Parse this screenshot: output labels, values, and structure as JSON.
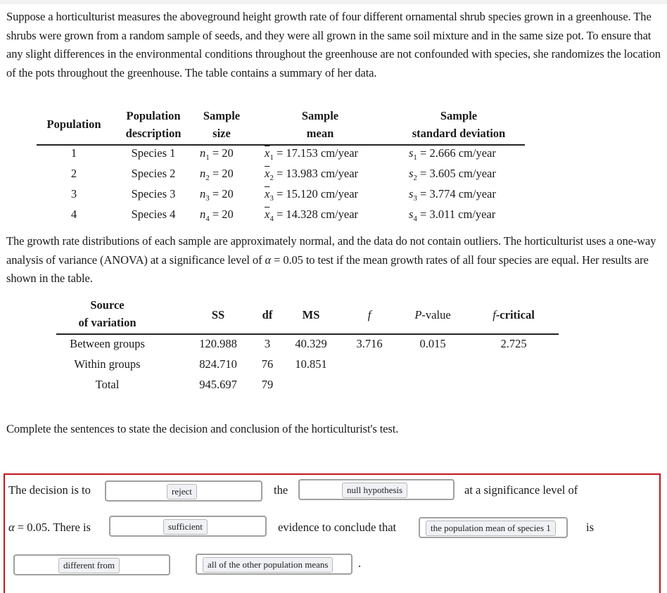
{
  "intro_text": "Suppose a horticulturist measures the aboveground height growth rate of four different ornamental shrub species grown in a greenhouse. The shrubs were grown from a random sample of seeds, and they were all grown in the same soil mixture and in the same size pot. To ensure that any slight differences in the environmental conditions throughout the greenhouse are not confounded with species, she randomizes the location of the pots throughout the greenhouse. The table contains a summary of her data.",
  "summary_table": {
    "headers": {
      "population": "Population",
      "description_1": "Population",
      "description_2": "description",
      "size_1": "Sample",
      "size_2": "size",
      "mean_1": "Sample",
      "mean_2": "mean",
      "sd_1": "Sample",
      "sd_2": "standard deviation"
    },
    "rows": [
      {
        "population": "1",
        "description": "Species 1",
        "n_sym": "n",
        "n_sub": "1",
        "n_val": " = 20",
        "x_sym": "x",
        "x_sub": "1",
        "mean": " = 17.153 cm/year",
        "s_sym": "s",
        "s_sub": "1",
        "sd": " = 2.666 cm/year"
      },
      {
        "population": "2",
        "description": "Species 2",
        "n_sym": "n",
        "n_sub": "2",
        "n_val": " = 20",
        "x_sym": "x",
        "x_sub": "2",
        "mean": " = 13.983 cm/year",
        "s_sym": "s",
        "s_sub": "2",
        "sd": " = 3.605 cm/year"
      },
      {
        "population": "3",
        "description": "Species 3",
        "n_sym": "n",
        "n_sub": "3",
        "n_val": " = 20",
        "x_sym": "x",
        "x_sub": "3",
        "mean": " = 15.120 cm/year",
        "s_sym": "s",
        "s_sub": "3",
        "sd": " = 3.774 cm/year"
      },
      {
        "population": "4",
        "description": "Species 4",
        "n_sym": "n",
        "n_sub": "4",
        "n_val": " = 20",
        "x_sym": "x",
        "x_sub": "4",
        "mean": " = 14.328 cm/year",
        "s_sym": "s",
        "s_sub": "4",
        "sd": " = 3.011 cm/year"
      }
    ]
  },
  "middle_text": {
    "part1": "The growth rate distributions of each sample are approximately normal, and the data do not contain outliers. The horticulturist uses a one-way analysis of variance (ANOVA) at a significance level of ",
    "alpha": "α",
    "part2": " = 0.05 to test if the mean growth rates of all four species are equal. Her results are shown in the table."
  },
  "anova_table": {
    "headers": {
      "source_1": "Source",
      "source_2": "of variation",
      "ss": "SS",
      "df": "df",
      "ms": "MS",
      "f": "f",
      "p_italic": "P",
      "p_rest": "-value",
      "fcrit_italic": "f",
      "fcrit_rest": "-critical"
    },
    "rows": [
      {
        "source": "Between groups",
        "ss": "120.988",
        "df": "3",
        "ms": "40.329",
        "f": "3.716",
        "p": "0.015",
        "fcrit": "2.725"
      },
      {
        "source": "Within groups",
        "ss": "824.710",
        "df": "76",
        "ms": "10.851",
        "f": "",
        "p": "",
        "fcrit": ""
      },
      {
        "source": "Total",
        "ss": "945.697",
        "df": "79",
        "ms": "",
        "f": "",
        "p": "",
        "fcrit": ""
      }
    ]
  },
  "instruction": "Complete the sentences to state the decision and conclusion of the horticulturist's test.",
  "answer": {
    "text_decision": "The decision is to",
    "text_the": "the",
    "text_at_level": "at a significance level of",
    "alpha_sym": "α",
    "text_alpha_val": " = 0.05. There is",
    "text_evidence": "evidence to conclude that",
    "text_is": "is",
    "text_period": ".",
    "slots": {
      "decision": "reject",
      "hypothesis": "null hypothesis",
      "evidence": "sufficient",
      "subject": "the population mean of species 1",
      "relation": "different from",
      "comparison": "all of the other population means"
    },
    "border_color": "#c4161c"
  }
}
